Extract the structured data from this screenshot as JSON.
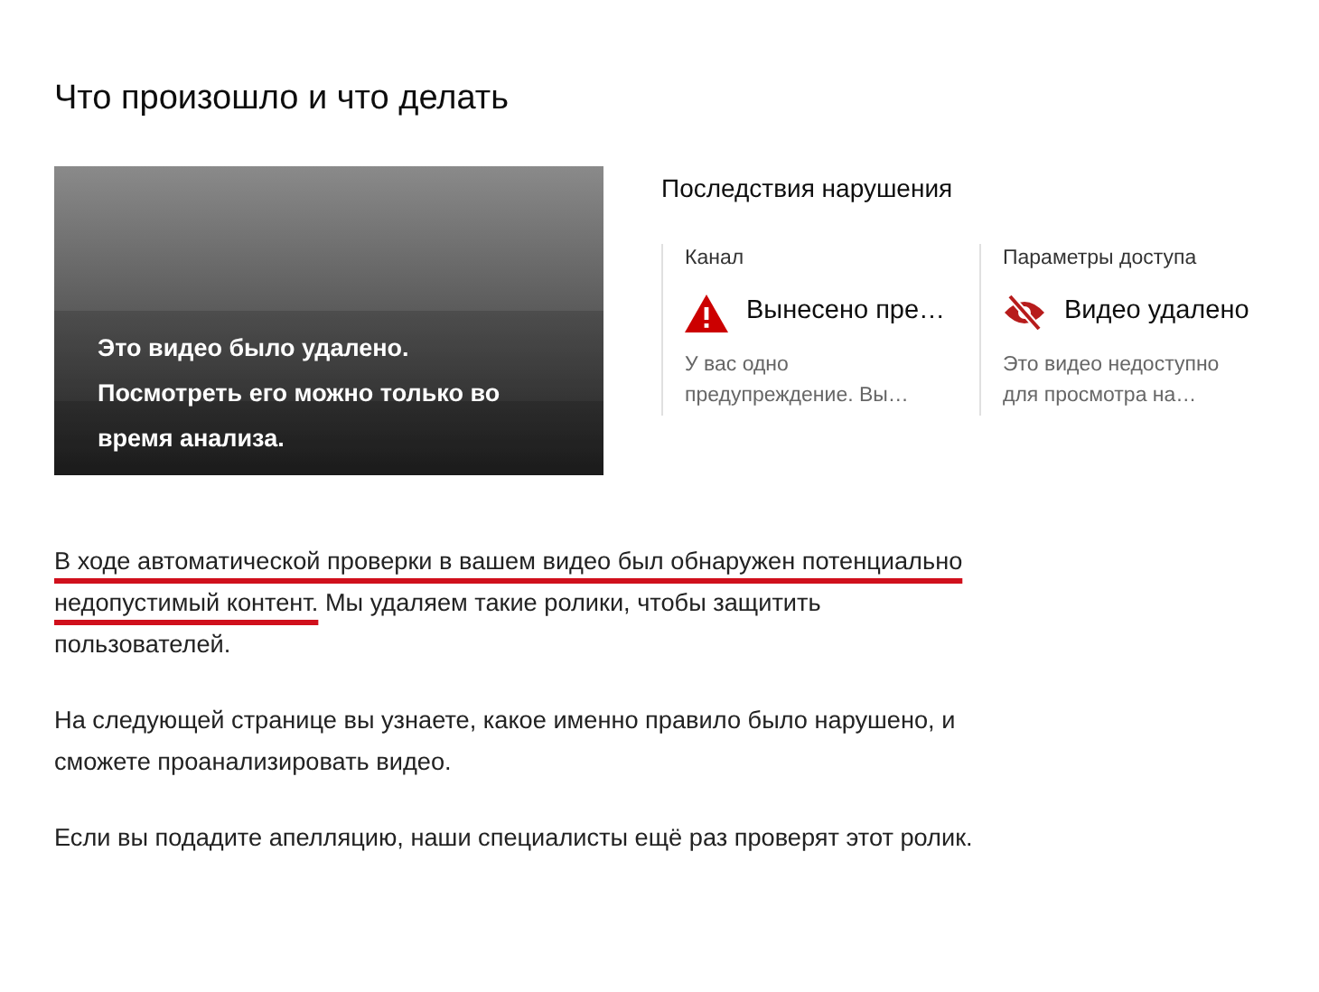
{
  "title": "Что произошло и что делать",
  "video": {
    "message": "Это видео было удалено. Посмотреть его можно только во время анализа."
  },
  "consequences": {
    "heading": "Последствия нарушения",
    "cards": [
      {
        "label": "Канал",
        "kind": "warning",
        "status": "Вынесено пре…",
        "description": "У вас одно предупреждение. Вы…"
      },
      {
        "label": "Параметры доступа",
        "kind": "hidden",
        "status": "Видео удалено",
        "description": "Это видео недоступно для просмотра на…"
      }
    ]
  },
  "paragraphs": [
    {
      "underlined": "В ходе автоматической проверки в вашем видео был обнаружен потенциально недопустимый контент.",
      "text": " Мы удаляем такие ролики, чтобы защитить пользователей."
    },
    {
      "text": "На следующей странице вы узнаете, какое именно правило было нарушено, и сможете проанализировать видео."
    },
    {
      "text": "Если вы подадите апелляцию, наши специалисты ещё раз проверят этот ролик."
    }
  ]
}
